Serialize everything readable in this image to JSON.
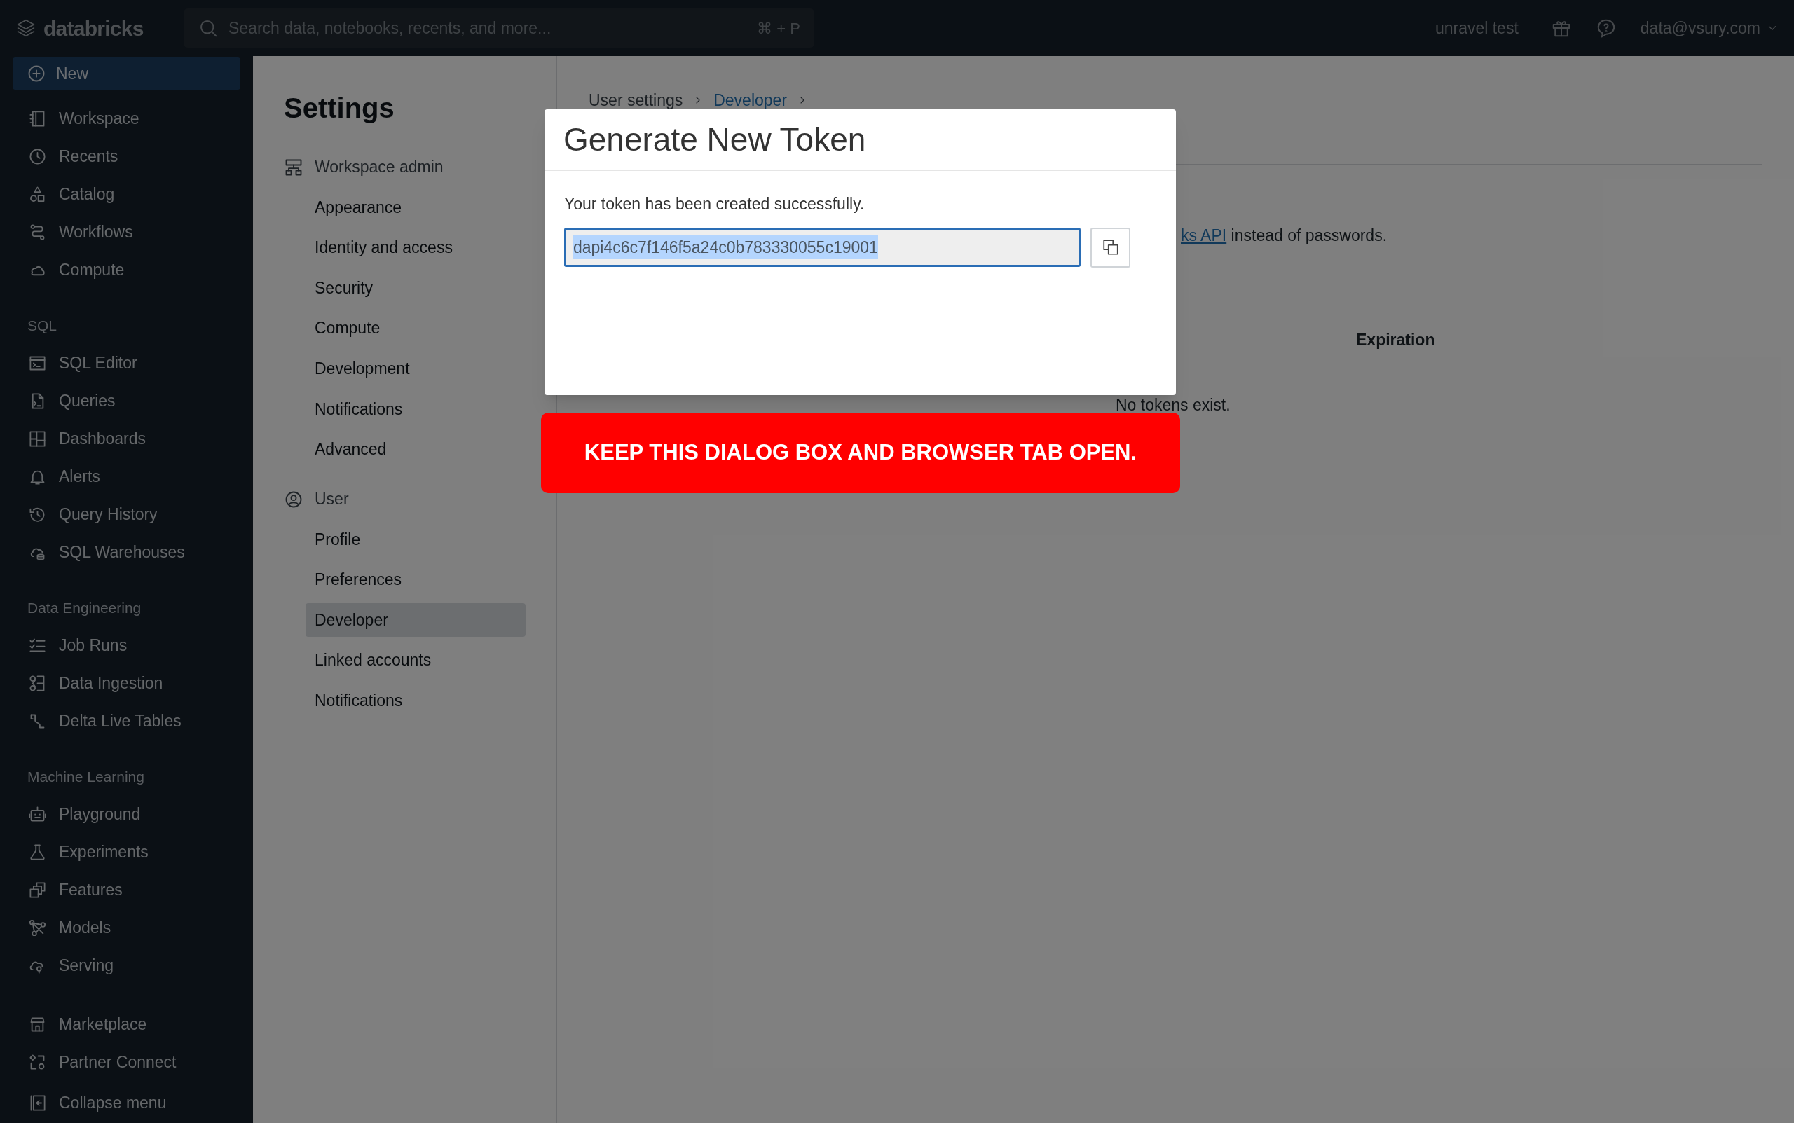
{
  "top_bar": {
    "logo": "databricks",
    "search": {
      "placeholder": "Search data, notebooks, recents, and more...",
      "shortcut": "⌘ + P"
    },
    "workspace": "unravel test",
    "user": "data@vsury.com"
  },
  "sidebar": {
    "new_button": "New",
    "sections": [
      {
        "items": [
          {
            "label": "Workspace"
          },
          {
            "label": "Recents"
          },
          {
            "label": "Catalog"
          },
          {
            "label": "Workflows"
          },
          {
            "label": "Compute"
          }
        ]
      },
      {
        "heading": "SQL",
        "items": [
          {
            "label": "SQL Editor"
          },
          {
            "label": "Queries"
          },
          {
            "label": "Dashboards"
          },
          {
            "label": "Alerts"
          },
          {
            "label": "Query History"
          },
          {
            "label": "SQL Warehouses"
          }
        ]
      },
      {
        "heading": "Data Engineering",
        "items": [
          {
            "label": "Job Runs"
          },
          {
            "label": "Data Ingestion"
          },
          {
            "label": "Delta Live Tables"
          }
        ]
      },
      {
        "heading": "Machine Learning",
        "items": [
          {
            "label": "Playground"
          },
          {
            "label": "Experiments"
          },
          {
            "label": "Features"
          },
          {
            "label": "Models"
          },
          {
            "label": "Serving"
          }
        ]
      },
      {
        "items": [
          {
            "label": "Marketplace"
          },
          {
            "label": "Partner Connect"
          }
        ]
      }
    ],
    "collapse": "Collapse menu"
  },
  "settings_nav": {
    "title": "Settings",
    "groups": [
      {
        "label": "Workspace admin",
        "items": [
          {
            "label": "Appearance",
            "selected": false
          },
          {
            "label": "Identity and access",
            "selected": false
          },
          {
            "label": "Security",
            "selected": false
          },
          {
            "label": "Compute",
            "selected": false
          },
          {
            "label": "Development",
            "selected": false
          },
          {
            "label": "Notifications",
            "selected": false
          },
          {
            "label": "Advanced",
            "selected": false
          }
        ]
      },
      {
        "label": "User",
        "items": [
          {
            "label": "Profile",
            "selected": false
          },
          {
            "label": "Preferences",
            "selected": false
          },
          {
            "label": "Developer",
            "selected": true
          },
          {
            "label": "Linked accounts",
            "selected": false
          },
          {
            "label": "Notifications",
            "selected": false
          }
        ]
      }
    ]
  },
  "main": {
    "breadcrumb": [
      {
        "label": "User settings",
        "link": false
      },
      {
        "label": "Developer",
        "link": true
      }
    ],
    "description_link": "ks API",
    "description_rest": "instead of passwords.",
    "table": {
      "column_header": "Expiration",
      "empty_message": "No tokens exist."
    }
  },
  "dialog": {
    "title": "Generate New Token",
    "message": "Your token has been created successfully.",
    "token": "dapi4c6c7f146f5a24c0b783330055c19001",
    "token_selected": true
  },
  "banner": "KEEP THIS DIALOG BOX AND BROWSER TAB OPEN."
}
